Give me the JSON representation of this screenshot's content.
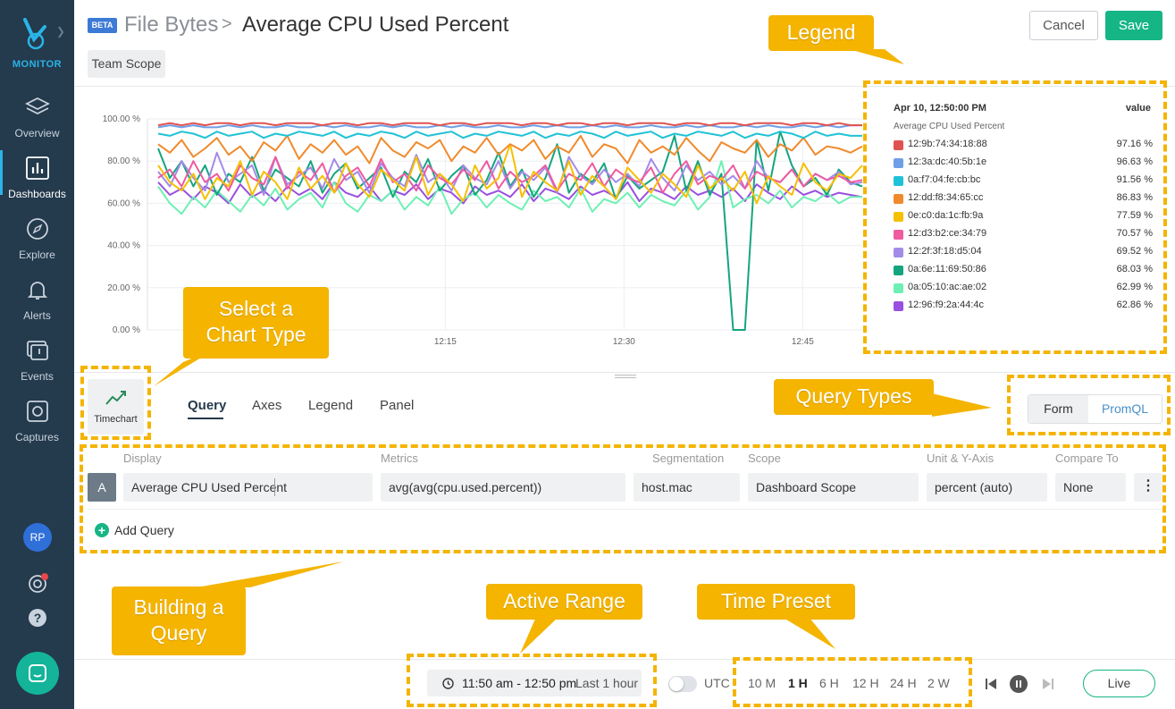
{
  "sidebar": {
    "brand": "MONITOR",
    "items": [
      {
        "label": "Overview",
        "icon": "layers-icon"
      },
      {
        "label": "Dashboards",
        "icon": "bar-chart-icon",
        "active": true
      },
      {
        "label": "Explore",
        "icon": "compass-icon"
      },
      {
        "label": "Alerts",
        "icon": "bell-icon"
      },
      {
        "label": "Events",
        "icon": "events-icon"
      },
      {
        "label": "Captures",
        "icon": "capture-icon"
      }
    ],
    "avatar_initials": "RP"
  },
  "header": {
    "badge": "BETA",
    "parent": "File Bytes",
    "separator": ">",
    "title": "Average CPU Used Percent",
    "scope": "Team Scope",
    "cancel_label": "Cancel",
    "save_label": "Save"
  },
  "colors": {
    "accent": "#16b586",
    "sidebar": "#243a4d",
    "annotation": "#f4b400"
  },
  "chart_data": {
    "type": "line",
    "title": "",
    "xlabel": "",
    "ylabel": "",
    "yticks": [
      "100.00 %",
      "80.00 %",
      "60.00 %",
      "40.00 %",
      "20.00 %",
      "0.00 %"
    ],
    "xticks": [
      "12:15",
      "12:30",
      "12:45"
    ],
    "ylim": [
      0,
      100
    ],
    "xlim": [
      "11:50",
      "12:50"
    ],
    "grid": true,
    "series": [
      {
        "name": "12:9b:74:34:18:88",
        "color": "#e0524f",
        "values": [
          97,
          98,
          97,
          98,
          97,
          98,
          98,
          97,
          98,
          98,
          97,
          98,
          98,
          98,
          97,
          98,
          98,
          97,
          98,
          98,
          97,
          98,
          98,
          98,
          97,
          98,
          98,
          97,
          98,
          98,
          98,
          97,
          98,
          98,
          97,
          98,
          98,
          97,
          98,
          98,
          97,
          98,
          98,
          98,
          97,
          98,
          98,
          97,
          98,
          98,
          97,
          98,
          98,
          98,
          97,
          98,
          98,
          97,
          98,
          97,
          97
        ]
      },
      {
        "name": "12:3a:dc:40:5b:1e",
        "color": "#6f9fe6",
        "values": [
          96,
          97,
          96,
          97,
          96,
          96,
          97,
          96,
          97,
          96,
          96,
          97,
          96,
          96,
          97,
          96,
          97,
          96,
          96,
          97,
          96,
          97,
          96,
          96,
          97,
          96,
          97,
          96,
          96,
          97,
          96,
          96,
          97,
          96,
          97,
          96,
          96,
          97,
          96,
          97,
          96,
          96,
          97,
          96,
          96,
          97,
          96,
          97,
          96,
          96,
          97,
          96,
          97,
          96,
          96,
          97,
          96,
          97,
          96,
          97,
          97
        ]
      },
      {
        "name": "0a:f7:04:fe:cb:bc",
        "color": "#1fc2d6",
        "values": [
          93,
          92,
          94,
          93,
          91,
          94,
          92,
          93,
          94,
          91,
          93,
          92,
          94,
          93,
          92,
          94,
          91,
          93,
          92,
          94,
          93,
          91,
          94,
          92,
          93,
          94,
          91,
          93,
          92,
          94,
          93,
          92,
          94,
          91,
          93,
          92,
          94,
          93,
          91,
          94,
          92,
          93,
          94,
          91,
          93,
          92,
          94,
          93,
          92,
          94,
          91,
          93,
          92,
          94,
          93,
          91,
          94,
          92,
          93,
          92,
          92
        ]
      },
      {
        "name": "12:dd:f8:34:65:cc",
        "color": "#f08a2c",
        "values": [
          88,
          84,
          90,
          82,
          86,
          91,
          83,
          87,
          80,
          89,
          85,
          92,
          81,
          88,
          84,
          90,
          83,
          87,
          79,
          91,
          85,
          82,
          89,
          86,
          90,
          80,
          87,
          84,
          91,
          83,
          88,
          85,
          90,
          81,
          87,
          84,
          92,
          82,
          88,
          86,
          79,
          90,
          84,
          87,
          83,
          91,
          85,
          80,
          89,
          86,
          84,
          90,
          82,
          88,
          85,
          91,
          83,
          87,
          86,
          84,
          87
        ]
      },
      {
        "name": "0e:c0:da:1c:fb:9a",
        "color": "#f5c000",
        "values": [
          78,
          70,
          66,
          74,
          62,
          72,
          68,
          80,
          64,
          75,
          70,
          62,
          77,
          67,
          73,
          65,
          79,
          69,
          63,
          76,
          71,
          66,
          82,
          64,
          74,
          69,
          61,
          78,
          67,
          72,
          88,
          63,
          75,
          70,
          66,
          80,
          64,
          73,
          68,
          62,
          77,
          71,
          65,
          74,
          69,
          63,
          78,
          67,
          72,
          66,
          75,
          60,
          73,
          68,
          64,
          79,
          70,
          66,
          74,
          72,
          78
        ]
      },
      {
        "name": "12:d3:b2:ce:34:79",
        "color": "#ef5aa0",
        "values": [
          72,
          76,
          68,
          80,
          70,
          74,
          66,
          78,
          72,
          69,
          82,
          67,
          75,
          71,
          79,
          65,
          73,
          77,
          68,
          81,
          70,
          74,
          66,
          78,
          72,
          69,
          76,
          71,
          80,
          67,
          75,
          70,
          73,
          78,
          66,
          74,
          71,
          79,
          68,
          76,
          72,
          70,
          77,
          65,
          74,
          80,
          69,
          73,
          71,
          78,
          67,
          75,
          72,
          70,
          76,
          68,
          74,
          71,
          73,
          70,
          71
        ]
      },
      {
        "name": "12:2f:3f:18:d5:04",
        "color": "#a38be8",
        "values": [
          75,
          68,
          80,
          72,
          66,
          84,
          70,
          74,
          78,
          64,
          82,
          69,
          73,
          77,
          67,
          81,
          71,
          75,
          65,
          79,
          72,
          68,
          83,
          70,
          74,
          66,
          78,
          72,
          69,
          80,
          67,
          75,
          71,
          77,
          65,
          82,
          73,
          69,
          76,
          70,
          74,
          68,
          81,
          72,
          66,
          78,
          71,
          75,
          69,
          73,
          67,
          80,
          72,
          70,
          76,
          68,
          74,
          71,
          75,
          69,
          70
        ]
      },
      {
        "name": "0a:6e:11:69:50:86",
        "color": "#14a57e",
        "values": [
          86,
          72,
          80,
          68,
          78,
          64,
          74,
          70,
          82,
          66,
          76,
          72,
          68,
          80,
          65,
          74,
          79,
          67,
          72,
          77,
          63,
          75,
          70,
          81,
          66,
          73,
          78,
          64,
          71,
          84,
          68,
          76,
          63,
          72,
          88,
          65,
          74,
          70,
          79,
          62,
          73,
          67,
          71,
          75,
          92,
          66,
          80,
          64,
          74,
          0,
          0,
          90,
          66,
          94,
          78,
          68,
          72,
          64,
          76,
          70,
          68
        ]
      },
      {
        "name": "0a:05:10:ac:ae:02",
        "color": "#6ef0b4",
        "values": [
          68,
          60,
          55,
          63,
          58,
          66,
          61,
          56,
          64,
          59,
          67,
          57,
          62,
          65,
          58,
          70,
          60,
          56,
          64,
          61,
          66,
          57,
          63,
          59,
          68,
          55,
          62,
          65,
          58,
          64,
          60,
          57,
          66,
          61,
          63,
          58,
          67,
          56,
          62,
          60,
          65,
          58,
          64,
          61,
          59,
          66,
          57,
          63,
          80,
          58,
          62,
          64,
          60,
          66,
          58,
          63,
          61,
          65,
          60,
          63,
          63
        ]
      },
      {
        "name": "12:96:f9:2a:44:4c",
        "color": "#9a4fe0",
        "values": [
          70,
          64,
          67,
          62,
          68,
          65,
          60,
          69,
          63,
          66,
          61,
          68,
          64,
          67,
          62,
          70,
          65,
          63,
          68,
          61,
          66,
          64,
          69,
          62,
          67,
          65,
          60,
          68,
          64,
          66,
          63,
          69,
          61,
          67,
          65,
          62,
          68,
          64,
          66,
          63,
          70,
          61,
          67,
          65,
          62,
          68,
          64,
          66,
          63,
          67,
          61,
          69,
          65,
          62,
          68,
          64,
          66,
          63,
          65,
          64,
          63
        ]
      }
    ]
  },
  "legend": {
    "date": "Apr 10, 12:50:00 PM",
    "value_header": "value",
    "metric": "Average CPU Used Percent",
    "rows": [
      {
        "name": "12:9b:74:34:18:88",
        "value": "97.16 %",
        "color": "#e0524f"
      },
      {
        "name": "12:3a:dc:40:5b:1e",
        "value": "96.63 %",
        "color": "#6f9fe6"
      },
      {
        "name": "0a:f7:04:fe:cb:bc",
        "value": "91.56 %",
        "color": "#1fc2d6"
      },
      {
        "name": "12:dd:f8:34:65:cc",
        "value": "86.83 %",
        "color": "#f08a2c"
      },
      {
        "name": "0e:c0:da:1c:fb:9a",
        "value": "77.59 %",
        "color": "#f5c000"
      },
      {
        "name": "12:d3:b2:ce:34:79",
        "value": "70.57 %",
        "color": "#ef5aa0"
      },
      {
        "name": "12:2f:3f:18:d5:04",
        "value": "69.52 %",
        "color": "#a38be8"
      },
      {
        "name": "0a:6e:11:69:50:86",
        "value": "68.03 %",
        "color": "#14a57e"
      },
      {
        "name": "0a:05:10:ac:ae:02",
        "value": "62.99 %",
        "color": "#6ef0b4"
      },
      {
        "name": "12:96:f9:2a:44:4c",
        "value": "62.86 %",
        "color": "#9a4fe0"
      }
    ]
  },
  "editor": {
    "chart_type": "Timechart",
    "tabs": [
      "Query",
      "Axes",
      "Legend",
      "Panel"
    ],
    "active_tab": "Query",
    "query_types": [
      "Form",
      "PromQL"
    ],
    "columns": [
      "Display",
      "Metrics",
      "Segmentation",
      "Scope",
      "Unit & Y-Axis",
      "Compare To"
    ],
    "query": {
      "letter": "A",
      "display": "Average CPU Used Percent",
      "metrics": "avg(avg(cpu.used.percent))",
      "segmentation": "host.mac",
      "scope": "Dashboard Scope",
      "unit": "percent (auto)",
      "compare": "None"
    },
    "add_query": "Add Query"
  },
  "footer": {
    "range": "11:50 am - 12:50 pm",
    "range_label": "Last 1 hour",
    "utc": "UTC",
    "presets": [
      "10 M",
      "1 H",
      "6 H",
      "12 H",
      "24 H",
      "2 W"
    ],
    "active_preset": "1 H",
    "live": "Live"
  },
  "annotations": {
    "legend": "Legend",
    "chart_type_line1": "Select a",
    "chart_type_line2": "Chart Type",
    "query_types": "Query Types",
    "building_line1": "Building a",
    "building_line2": "Query",
    "active_range": "Active Range",
    "time_preset": "Time Preset"
  }
}
